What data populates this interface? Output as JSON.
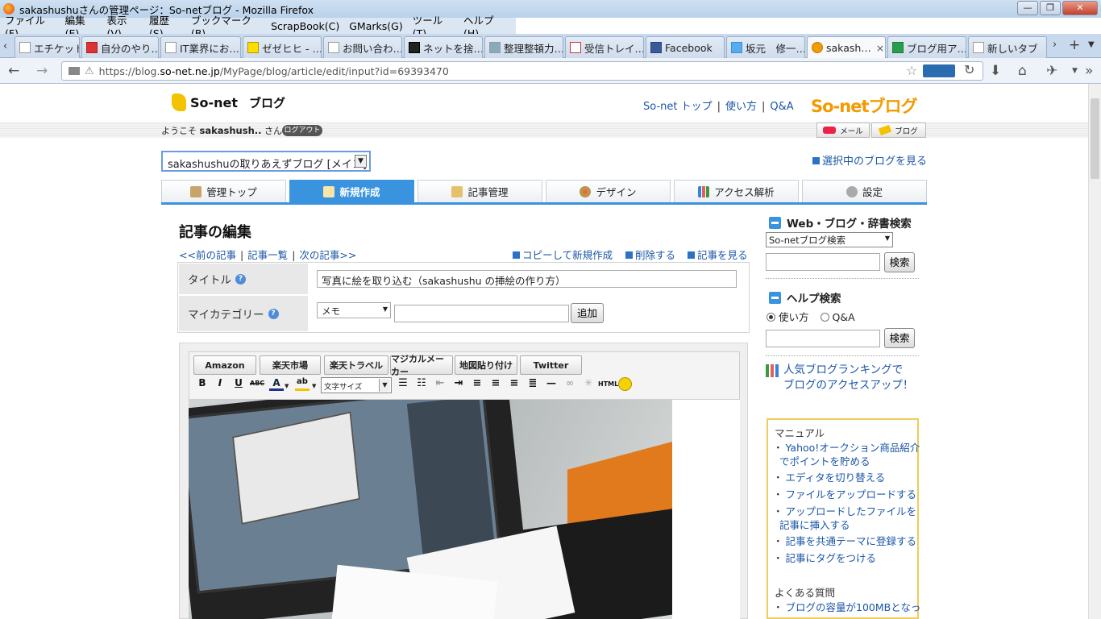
{
  "window": {
    "title": "sakashushuさんの管理ページ：So-netブログ - Mozilla Firefox",
    "controls": {
      "minimize": "—",
      "maximize": "❐",
      "close": "✕"
    }
  },
  "menu": [
    "ファイル(F)",
    "編集(E)",
    "表示(V)",
    "履歴(S)",
    "ブックマーク(B)",
    "ScrapBook(C)",
    "GMarks(G)",
    "ツール(T)",
    "ヘルプ(H)"
  ],
  "tabs": [
    {
      "label": "エチケット…"
    },
    {
      "label": "自分のやり…"
    },
    {
      "label": "IT業界にお…"
    },
    {
      "label": "ゼゼヒヒ - …"
    },
    {
      "label": "お問い合わ…"
    },
    {
      "label": "ネットを捨…"
    },
    {
      "label": "整理整頓力…"
    },
    {
      "label": "受信トレイ…"
    },
    {
      "label": "Facebook"
    },
    {
      "label": "坂元　修一…"
    },
    {
      "label": "sakash…"
    },
    {
      "label": "ブログ用ア…"
    },
    {
      "label": "新しいタブ"
    }
  ],
  "url": {
    "prefix": "https://blog.",
    "domain": "so-net.ne.jp",
    "path": "/MyPage/blog/article/edit/input?id=69393470"
  },
  "header": {
    "logo": "So-net",
    "logo_sub": "ブログ",
    "links": [
      "So-net トップ",
      "使い方",
      "Q&A"
    ],
    "brand": "So-netブログ",
    "welcome_prefix": "ようこそ",
    "user": "sakashush..",
    "welcome_suffix": "さん",
    "logout": "ログアウト",
    "mail_btn": "メール",
    "blog_btn": "ブログ"
  },
  "blog_select": {
    "value": "sakashushuの取りあえずブログ [メイン]"
  },
  "view_blog": "選択中のブログを見る",
  "nav_tabs": [
    {
      "label": "管理トップ",
      "active": false
    },
    {
      "label": "新規作成",
      "active": true
    },
    {
      "label": "記事管理",
      "active": false
    },
    {
      "label": "デザイン",
      "active": false
    },
    {
      "label": "アクセス解析",
      "active": false
    },
    {
      "label": "設定",
      "active": false
    }
  ],
  "editor": {
    "heading": "記事の編集",
    "prev": "<<前の記事",
    "list": "記事一覧",
    "next": "次の記事>>",
    "copy": "コピーして新規作成",
    "delete": "削除する",
    "view": "記事を見る",
    "title_label": "タイトル",
    "title_value": "写真に絵を取り込む（sakashushu の挿絵の作り方）",
    "category_label": "マイカテゴリー",
    "category_value": "メモ",
    "category_new_value": "",
    "add_btn": "追加",
    "ext_buttons": [
      "Amazon",
      "楽天市場",
      "楽天トラベル",
      "マジカルメーカー",
      "地図貼り付け",
      "Twitter"
    ],
    "font_select": "文字サイズ",
    "tools": [
      "B",
      "I",
      "U",
      "ABC",
      "A",
      "ab",
      "HTML"
    ]
  },
  "sidebar": {
    "search_title": "Web・ブログ・辞書検索",
    "search_select": "So-netブログ検索",
    "search_value": "",
    "search_btn": "検索",
    "help_title": "ヘルプ検索",
    "radio1": "使い方",
    "radio2": "Q&A",
    "help_value": "",
    "help_btn": "検索",
    "ranking_line1": "人気ブログランキングで",
    "ranking_line2": "ブログのアクセスアップ！",
    "manual_title": "マニュアル",
    "manual_links": [
      "Yahoo!オークション商品紹介",
      "でポイントを貯める",
      "エディタを切り替える",
      "ファイルをアップロードする",
      "アップロードしたファイルを",
      "記事に挿入する",
      "記事を共通テーマに登録する",
      "記事にタグをつける"
    ],
    "faq_title": "よくある質問",
    "faq_links": [
      "ブログの容量が100MBとなっ"
    ]
  }
}
